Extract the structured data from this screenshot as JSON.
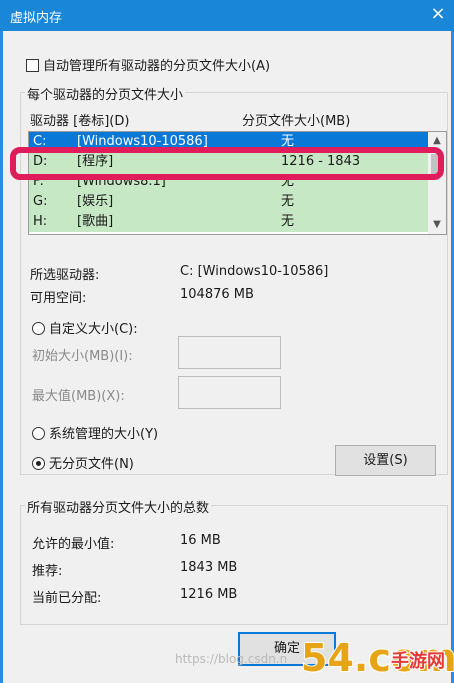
{
  "window": {
    "title": "虚拟内存",
    "close_icon": "×"
  },
  "auto_manage": {
    "label": "自动管理所有驱动器的分页文件大小(A)",
    "checked": false
  },
  "drives_group": {
    "title": "每个驱动器的分页文件大小",
    "col_drive": "驱动器 [卷标](D)",
    "col_size": "分页文件大小(MB)",
    "rows": [
      {
        "drive": "C:",
        "label": "[Windows10-10586]",
        "size": "无"
      },
      {
        "drive": "D:",
        "label": "[程序]",
        "size": "1216 - 1843"
      },
      {
        "drive": "F:",
        "label": "[Windows8.1]",
        "size": "无"
      },
      {
        "drive": "G:",
        "label": "[娱乐]",
        "size": "无"
      },
      {
        "drive": "H:",
        "label": "[歌曲]",
        "size": "无"
      }
    ],
    "selected_drive_label": "所选驱动器:",
    "selected_drive_value": "C:  [Windows10-10586]",
    "free_space_label": "可用空间:",
    "free_space_value": "104876 MB",
    "custom_size_label": "自定义大小(C):",
    "initial_size_label": "初始大小(MB)(I):",
    "max_size_label": "最大值(MB)(X):",
    "system_managed_label": "系统管理的大小(Y)",
    "no_paging_label": "无分页文件(N)",
    "set_button": "设置(S)",
    "selected_option": "no_paging"
  },
  "totals_group": {
    "title": "所有驱动器分页文件大小的总数",
    "min_allowed_label": "允许的最小值:",
    "min_allowed_value": "16 MB",
    "recommended_label": "推荐:",
    "recommended_value": "1843 MB",
    "current_label": "当前已分配:",
    "current_value": "1216 MB"
  },
  "footer": {
    "ok_button": "确定",
    "watermark": "https://blog.csdn.n"
  },
  "logo": {
    "text": "54.com",
    "brand_text": "手游网"
  },
  "colors": {
    "titlebar": "#1a86d8",
    "selection": "#0a78d7",
    "row_green": "#c7e8c5",
    "highlight_red": "#e01d5a"
  }
}
